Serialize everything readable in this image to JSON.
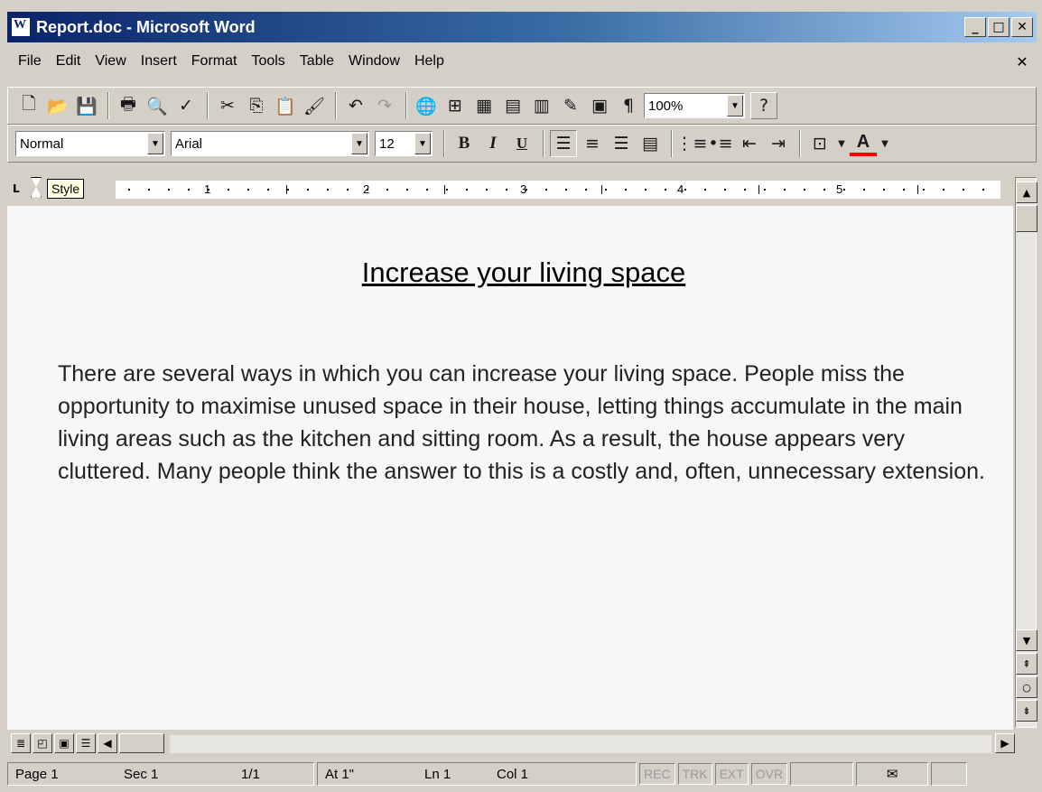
{
  "window": {
    "title": "Report.doc - Microsoft Word",
    "minimize": "_",
    "maximize": "□",
    "close": "✕"
  },
  "menu": {
    "items": [
      "File",
      "Edit",
      "View",
      "Insert",
      "Format",
      "Tools",
      "Table",
      "Window",
      "Help"
    ],
    "doc_close": "✕"
  },
  "standard_toolbar": {
    "icons": [
      "new-document-icon",
      "open-folder-icon",
      "save-disk-icon",
      "print-icon",
      "print-preview-icon",
      "spelling-icon",
      "cut-icon",
      "copy-icon",
      "paste-icon",
      "format-painter-icon",
      "undo-icon",
      "redo-icon",
      "insert-hyperlink-icon",
      "tables-borders-icon",
      "insert-table-icon",
      "insert-excel-icon",
      "columns-icon",
      "drawing-icon",
      "document-map-icon",
      "show-formatting-icon"
    ],
    "pilcrow": "¶",
    "zoom": "100%",
    "help": "?"
  },
  "formatting_toolbar": {
    "style": "Normal",
    "font": "Arial",
    "font_size": "12",
    "bold": "B",
    "italic": "I",
    "underline": "U",
    "font_color": "A",
    "font_color_value": "#ff0000"
  },
  "ruler": {
    "tooltip": "Style",
    "numbers": [
      "1",
      "2",
      "3",
      "4",
      "5"
    ]
  },
  "document": {
    "heading": "Increase your living space",
    "paragraph": "There are several ways in which you can increase your living space. People miss the opportunity to maximise unused space in their house, letting things accumulate in the main living areas such as the kitchen and sitting room. As a result, the house appears very cluttered. Many people think the answer to this is a costly and, often, unnecessary  extension."
  },
  "status": {
    "page": "Page 1",
    "sec": "Sec 1",
    "pages": "1/1",
    "at": "At 1\"",
    "ln": "Ln 1",
    "col": "Col 1",
    "rec": "REC",
    "trk": "TRK",
    "ext": "EXT",
    "ovr": "OVR"
  }
}
